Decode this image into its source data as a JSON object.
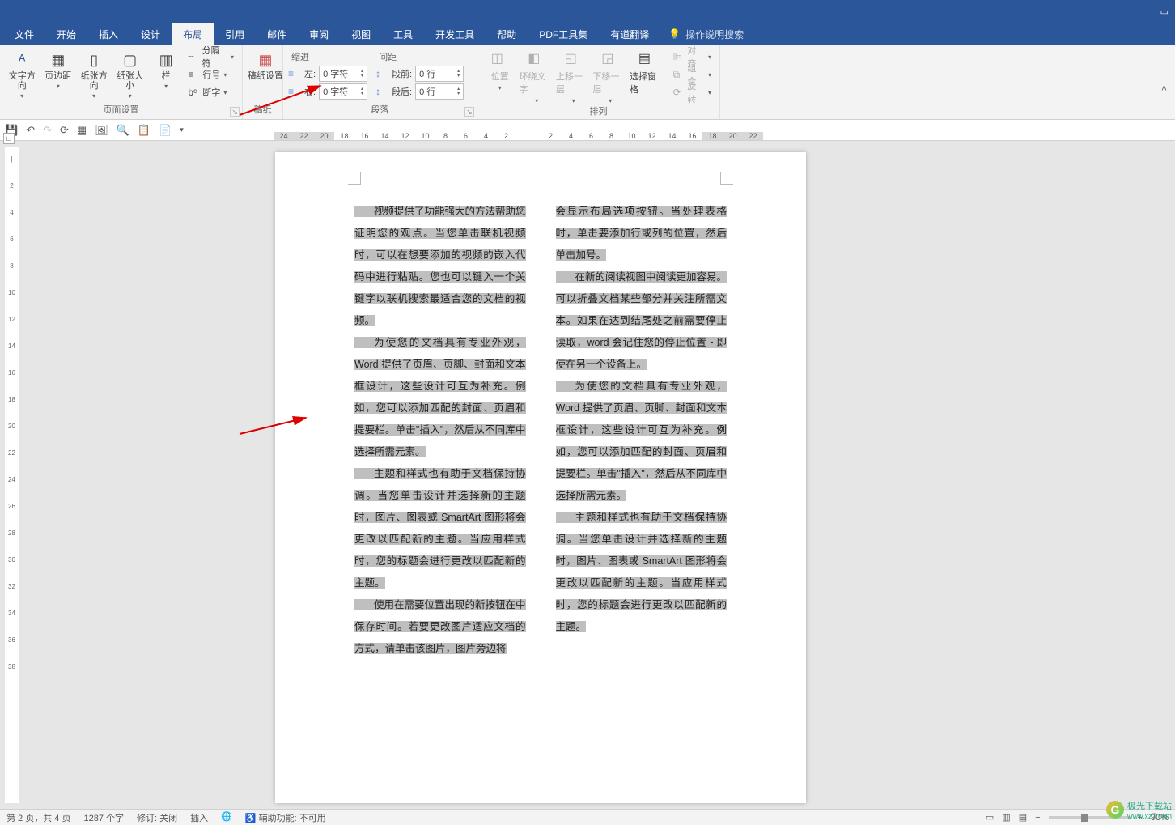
{
  "menubar": {
    "items": [
      "文件",
      "开始",
      "插入",
      "设计",
      "布局",
      "引用",
      "邮件",
      "审阅",
      "视图",
      "工具",
      "开发工具",
      "帮助",
      "PDF工具集",
      "有道翻译"
    ],
    "active_index": 4,
    "search_placeholder": "操作说明搜索"
  },
  "ribbon": {
    "page_setup": {
      "label": "页面设置",
      "text_direction": "文字方向",
      "margins": "页边距",
      "orientation": "纸张方向",
      "size": "纸张大小",
      "columns": "栏",
      "breaks": "分隔符",
      "line_numbers": "行号",
      "hyphenation": "断字"
    },
    "manuscript": {
      "label": "稿纸",
      "button": "稿纸设置"
    },
    "paragraph": {
      "label": "段落",
      "indent_label": "缩进",
      "spacing_label": "间距",
      "left_label": "左:",
      "right_label": "右:",
      "before_label": "段前:",
      "after_label": "段后:",
      "left_value": "0 字符",
      "right_value": "0 字符",
      "before_value": "0 行",
      "after_value": "0 行"
    },
    "arrange": {
      "label": "排列",
      "position": "位置",
      "wrap": "环绕文字",
      "forward": "上移一层",
      "backward": "下移一层",
      "selection": "选择窗格",
      "align": "对齐",
      "group": "组合",
      "rotate": "旋转"
    }
  },
  "document": {
    "col1": [
      "视频提供了功能强大的方法帮助您证明您的观点。当您单击联机视频时，可以在想要添加的视频的嵌入代码中进行粘贴。您也可以键入一个关键字以联机搜索最适合您的文档的视频。",
      "为使您的文档具有专业外观，Word 提供了页眉、页脚、封面和文本框设计，这些设计可互为补充。例如，您可以添加匹配的封面、页眉和提要栏。单击\"插入\"，然后从不同库中选择所需元素。",
      "主题和样式也有助于文档保持协调。当您单击设计并选择新的主题时，图片、图表或 SmartArt 图形将会更改以匹配新的主题。当应用样式时，您的标题会进行更改以匹配新的主题。",
      "使用在需要位置出现的新按钮在中保存时间。若要更改图片适应文档的方式，请单击该图片，图片旁边将"
    ],
    "col2": [
      "会显示布局选项按钮。当处理表格时，单击要添加行或列的位置，然后单击加号。",
      "在新的阅读视图中阅读更加容易。可以折叠文档某些部分并关注所需文本。如果在达到结尾处之前需要停止读取，word 会记住您的停止位置 - 即使在另一个设备上。",
      "为使您的文档具有专业外观，Word 提供了页眉、页脚、封面和文本框设计，这些设计可互为补充。例如，您可以添加匹配的封面、页眉和提要栏。单击\"插入\"，然后从不同库中选择所需元素。",
      "主题和样式也有助于文档保持协调。当您单击设计并选择新的主题时，图片、图表或 SmartArt 图形将会更改以匹配新的主题。当应用样式时，您的标题会进行更改以匹配新的主题。"
    ]
  },
  "ruler": {
    "h": [
      "24",
      "22",
      "20",
      "18",
      "16",
      "14",
      "12",
      "10",
      "8",
      "6",
      "4",
      "2",
      "",
      "2",
      "4",
      "6",
      "8",
      "10",
      "12",
      "14",
      "16",
      "18",
      "20",
      "22"
    ]
  },
  "statusbar": {
    "page": "第 2 页，共 4 页",
    "words": "1287 个字",
    "track": "修订: 关闭",
    "mode": "插入",
    "a11y": "辅助功能: 不可用",
    "zoom": "90%"
  },
  "watermark": {
    "text1": "极光下载站",
    "text2": "www.xz7.com"
  }
}
